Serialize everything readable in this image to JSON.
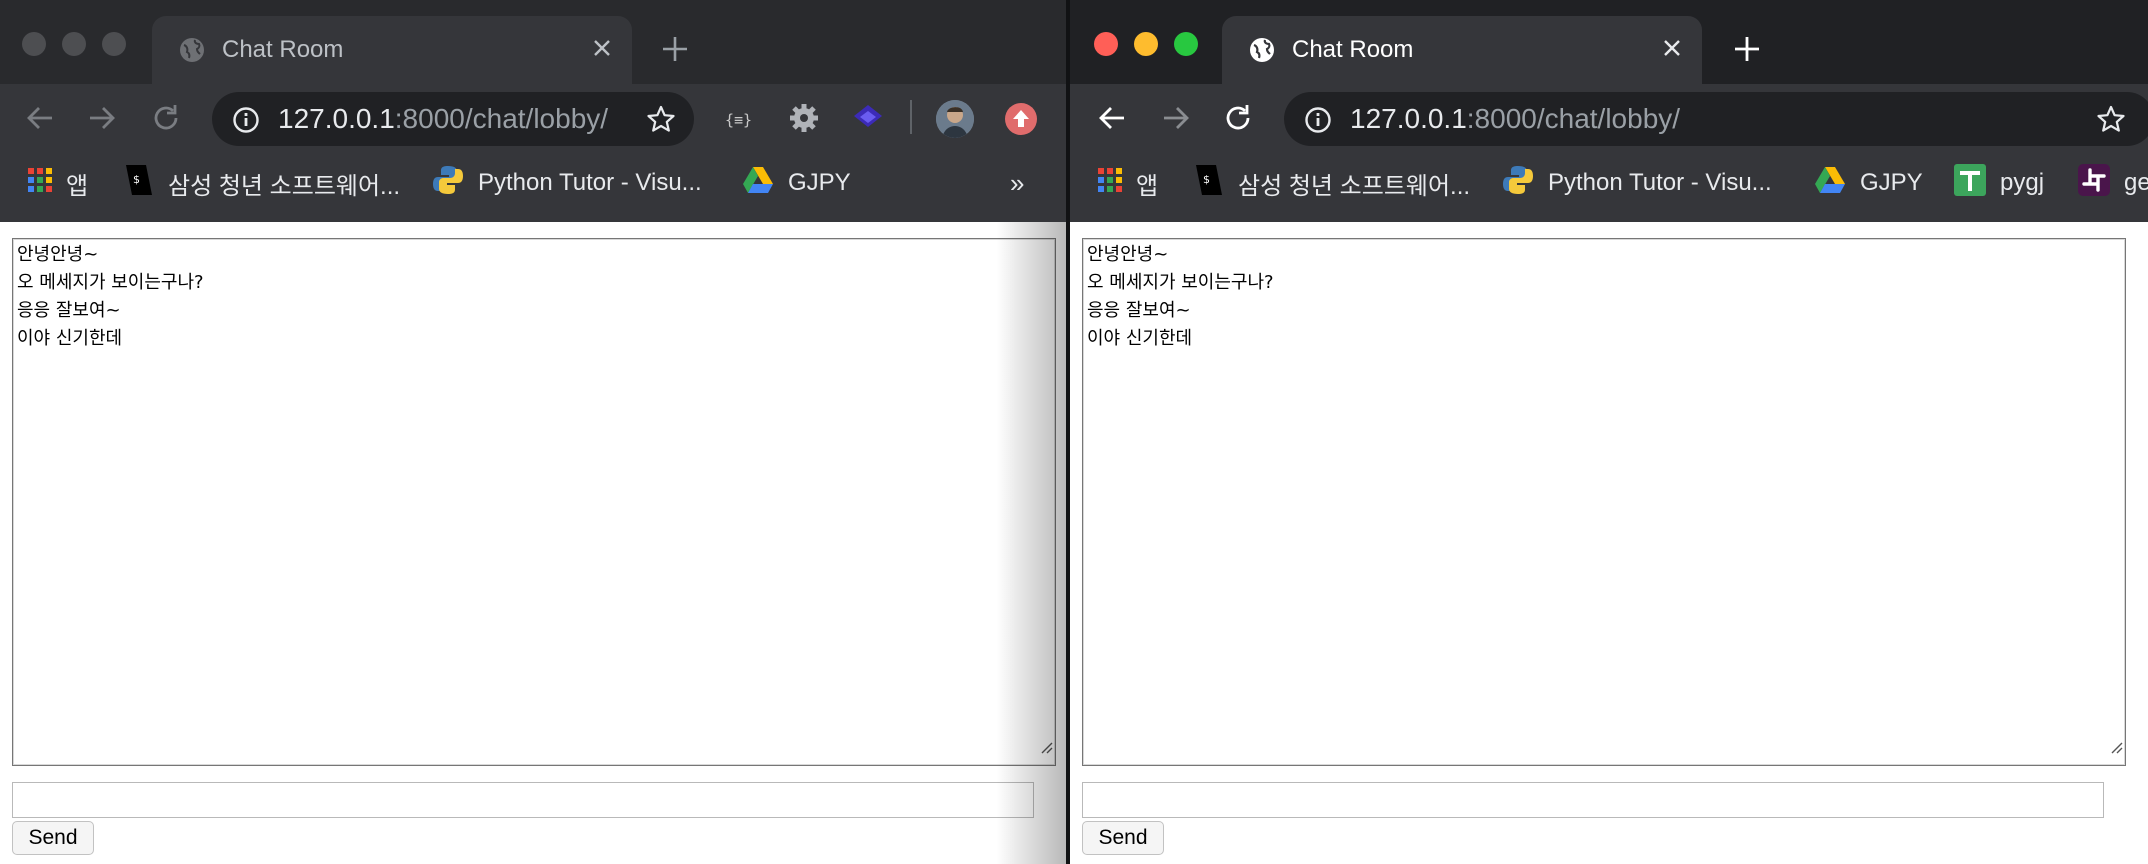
{
  "left_window": {
    "tab_title": "Chat Room",
    "url_host": "127.0.0.1",
    "url_rest": ":8000/chat/lobby/",
    "bookmarks": [
      "앱",
      "삼성 청년 소프트웨어...",
      "Python Tutor - Visu...",
      "GJPY"
    ],
    "bookmarks_overflow": "»",
    "extensions": [
      "json-viewer-icon",
      "gear-icon",
      "layers-icon",
      "profile-avatar",
      "upload-icon"
    ],
    "chat_log": [
      "안녕안녕~",
      "오 메세지가 보이는구나?",
      "응응 잘보여~",
      "이야 신기한데"
    ],
    "message_input_value": "",
    "send_label": "Send"
  },
  "right_window": {
    "tab_title": "Chat Room",
    "url_host": "127.0.0.1",
    "url_rest": ":8000/chat/lobby/",
    "bookmarks": [
      "앱",
      "삼성 청년 소프트웨어...",
      "Python Tutor - Visu...",
      "GJPY",
      "pygj",
      "ge"
    ],
    "chat_log": [
      "안녕안녕~",
      "오 메세지가 보이는구나?",
      "응응 잘보여~",
      "이야 신기한데"
    ],
    "message_input_value": "",
    "send_label": "Send"
  },
  "colors": {
    "traffic_red": "#ff5f57",
    "traffic_yellow": "#febc2e",
    "traffic_green": "#28c840",
    "chrome_dark": "#35363a",
    "upload_badge": "#e06c6c"
  }
}
